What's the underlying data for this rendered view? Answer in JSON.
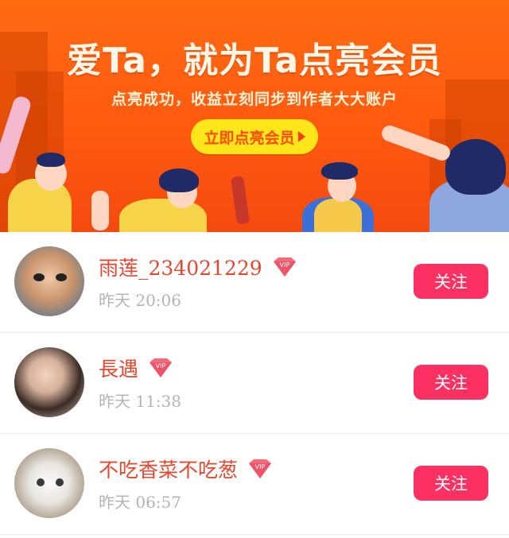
{
  "banner": {
    "title": "爱Ta，就为Ta点亮会员",
    "subtitle": "点亮成功，收益立刻同步到作者大大账户",
    "cta_label": "立即点亮会员"
  },
  "colors": {
    "banner_orange": "#ff5a10",
    "cta_yellow": "#ffe61a",
    "name_red": "#e5472d",
    "follow_pink": "#fa3162",
    "time_gray": "#b4b4b4"
  },
  "users": [
    {
      "name": "雨莲_234021229",
      "vip_badge": "VIP",
      "time": "昨天 20:06",
      "follow_label": "关注"
    },
    {
      "name": "長遇",
      "vip_badge": "VIP",
      "time": "昨天 11:38",
      "follow_label": "关注"
    },
    {
      "name": "不吃香菜不吃葱",
      "vip_badge": "VIP",
      "time": "昨天 06:57",
      "follow_label": "关注"
    }
  ]
}
